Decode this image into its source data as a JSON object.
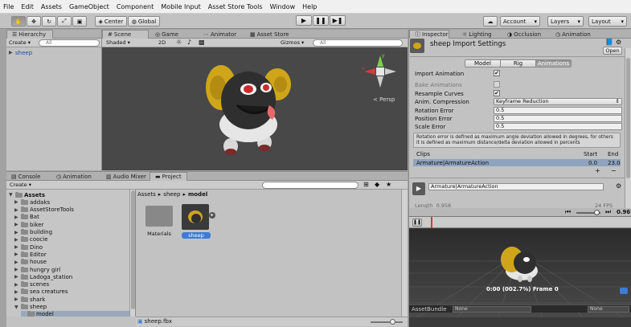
{
  "menu": [
    "File",
    "Edit",
    "Assets",
    "GameObject",
    "Component",
    "Mobile Input",
    "Asset Store Tools",
    "Window",
    "Help"
  ],
  "toolbar": {
    "center": "Center",
    "global": "Global",
    "account": "Account",
    "layers": "Layers",
    "layout": "Layout"
  },
  "hierarchy": {
    "tab": "Hierarchy",
    "create": "Create",
    "search_placeholder": "All",
    "item": "sheep"
  },
  "scene": {
    "tabs": [
      "Scene",
      "Game",
      "Animator",
      "Asset Store"
    ],
    "shaded": "Shaded",
    "mode_2d": "2D",
    "gizmos": "Gizmos",
    "search_placeholder": "All",
    "persp": "Persp"
  },
  "bottom_tabs": [
    "Console",
    "Animation",
    "Audio Mixer",
    "Project"
  ],
  "project": {
    "create": "Create",
    "breadcrumb": [
      "Assets",
      "sheep",
      "model"
    ],
    "tree": [
      "Assets",
      "addaks",
      "AssetStoreTools",
      "Bat",
      "biker",
      "building",
      "coocie",
      "Dino",
      "Editor",
      "house",
      "hungry girl",
      "Ladoga_station",
      "scenes",
      "sea creatures",
      "shark",
      "sheep",
      "model"
    ],
    "assets": [
      {
        "label": "Materials"
      },
      {
        "label": "sheep"
      }
    ],
    "footer_file": "sheep.fbx"
  },
  "inspector": {
    "tabs": [
      "Inspector",
      "Lighting",
      "Occlusion",
      "Animation"
    ],
    "title": "sheep Import Settings",
    "open": "Open",
    "subtabs": [
      "Model",
      "Rig",
      "Animations"
    ],
    "import_animation": "Import Animation",
    "bake_animations": "Bake Animations",
    "resample_curves": "Resample Curves",
    "anim_compression": "Anim. Compression",
    "anim_compression_value": "Keyframe Reduction",
    "rotation_error": "Rotation Error",
    "rotation_error_value": "0.5",
    "position_error": "Position Error",
    "position_error_value": "0.5",
    "scale_error": "Scale Error",
    "scale_error_value": "0.5",
    "help_text": "Rotation error is defined as maximum angle deviation allowed in degrees, for others it is defined as maximum distance/delta deviation allowed in percents",
    "clips_header": "Clips",
    "start_header": "Start",
    "end_header": "End",
    "clip_name": "Armature|ArmatureAction",
    "clip_start": "0.0",
    "clip_end": "23.0",
    "clip_field": "Armature|ArmatureAction",
    "length_label": "Length",
    "length_value": "0.958",
    "fps": "24 FPS"
  },
  "preview": {
    "speed": "0.96",
    "frame_text": "0:00 (002.7%) Frame 0",
    "assetbundle_label": "AssetBundle",
    "none1": "None",
    "none2": "None"
  },
  "colors": {
    "sceneBg": "#484848",
    "selection": "#3e7bd6",
    "sheepWool": "#cfa51a",
    "sheepBody": "#2f2f2f"
  }
}
